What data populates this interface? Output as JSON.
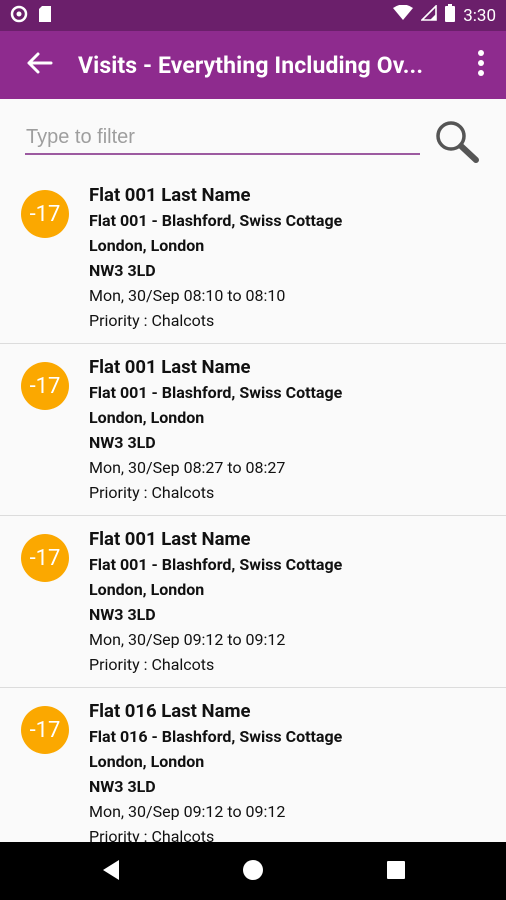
{
  "statusbar": {
    "time": "3:30"
  },
  "appbar": {
    "title": "Visits - Everything Including Ov..."
  },
  "filter": {
    "placeholder": "Type to filter",
    "value": ""
  },
  "visits": [
    {
      "badge": "-17",
      "name": "Flat 001 Last Name",
      "address1": "Flat 001 - Blashford, Swiss Cottage",
      "address2": "London, London",
      "postcode": "NW3 3LD",
      "datetime": "Mon, 30/Sep 08:10 to 08:10",
      "priority": "Priority : Chalcots"
    },
    {
      "badge": "-17",
      "name": "Flat 001 Last Name",
      "address1": "Flat 001 - Blashford, Swiss Cottage",
      "address2": "London, London",
      "postcode": "NW3 3LD",
      "datetime": "Mon, 30/Sep 08:27 to 08:27",
      "priority": "Priority : Chalcots"
    },
    {
      "badge": "-17",
      "name": "Flat 001 Last Name",
      "address1": "Flat 001 - Blashford, Swiss Cottage",
      "address2": "London, London",
      "postcode": "NW3 3LD",
      "datetime": "Mon, 30/Sep 09:12 to 09:12",
      "priority": "Priority : Chalcots"
    },
    {
      "badge": "-17",
      "name": "Flat 016 Last Name",
      "address1": "Flat 016 - Blashford, Swiss Cottage",
      "address2": "London, London",
      "postcode": "NW3 3LD",
      "datetime": "Mon, 30/Sep 09:12 to 09:12",
      "priority": "Priority : Chalcots"
    }
  ],
  "colors": {
    "statusbar": "#6b1f6b",
    "appbar": "#8e2b8e",
    "badge": "#fba800",
    "accent": "#9c5aa0"
  },
  "icons": {
    "status_left": [
      "notification-circle-icon",
      "sd-card-icon"
    ],
    "status_right": [
      "wifi-icon",
      "signal-icon",
      "battery-icon"
    ],
    "appbar": [
      "back-arrow-icon",
      "overflow-menu-icon"
    ],
    "filter": "search-icon",
    "nav": [
      "back-triangle-icon",
      "home-circle-icon",
      "recents-square-icon"
    ]
  }
}
